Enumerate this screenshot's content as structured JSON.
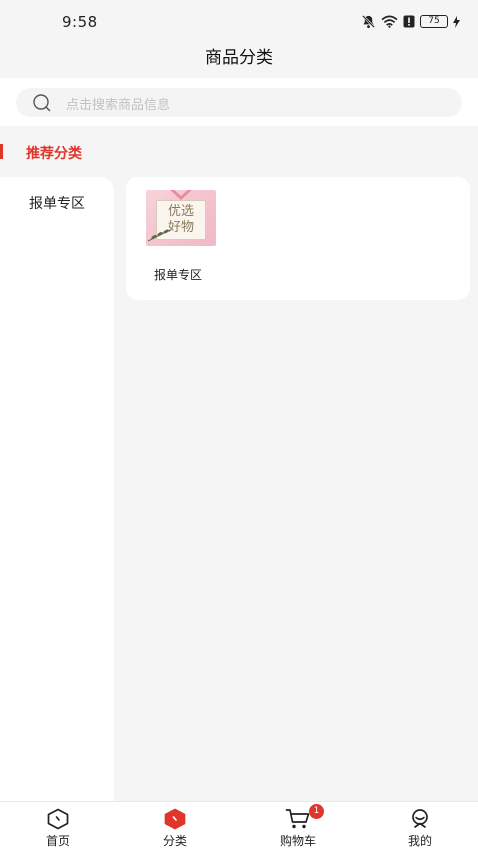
{
  "status_bar": {
    "time": "9:58",
    "battery": "75",
    "icons": [
      "mute-bell-icon",
      "wifi-icon",
      "alert-icon",
      "battery-icon",
      "charging-icon"
    ]
  },
  "header": {
    "title": "商品分类"
  },
  "search": {
    "placeholder": "点击搜索商品信息"
  },
  "section": {
    "title": "推荐分类"
  },
  "sidebar": {
    "items": [
      {
        "label": "报单专区"
      }
    ]
  },
  "content": {
    "products": [
      {
        "label": "报单专区",
        "image_text_line1": "优选",
        "image_text_line2": "好物"
      }
    ]
  },
  "bottom_nav": {
    "items": [
      {
        "label": "首页",
        "icon": "home-icon"
      },
      {
        "label": "分类",
        "icon": "category-icon"
      },
      {
        "label": "购物车",
        "icon": "cart-icon",
        "badge": "1"
      },
      {
        "label": "我的",
        "icon": "profile-icon"
      }
    ]
  },
  "colors": {
    "accent": "#e0352b",
    "background": "#f5f5f5",
    "card": "#ffffff"
  }
}
